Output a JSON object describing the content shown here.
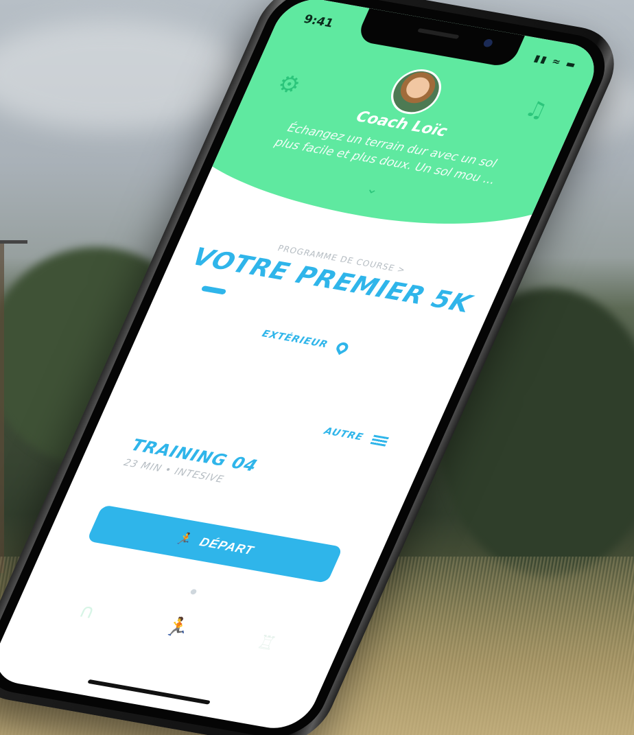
{
  "status_bar": {
    "time": "9:41",
    "signal": "▮▮ ≈ ▬"
  },
  "header": {
    "coach_name": "Coach Loïc",
    "message": "Échangez un terrain dur avec un sol plus facile et plus doux. Un sol mou ..."
  },
  "program": {
    "label": "PROGRAMME DE COURSE  >",
    "title": "VOTRE PREMIER 5K",
    "progress": 0.1
  },
  "location": {
    "label": "EXTÉRIEUR"
  },
  "filter": {
    "label": "AUTRE"
  },
  "training": {
    "title": "TRAINING 04",
    "meta": "23 MIN • INTESIVE"
  },
  "start_button": {
    "label": "DÉPART"
  },
  "colors": {
    "accent_green": "#5fe9a0",
    "accent_blue": "#2fb5ea"
  },
  "icons": {
    "settings": "gear-icon",
    "music": "music-note-icon",
    "location": "location-pin-icon",
    "menu": "menu-icon",
    "runner": "runner-icon",
    "headphones": "headphones-icon",
    "trophy": "trophy-icon"
  }
}
